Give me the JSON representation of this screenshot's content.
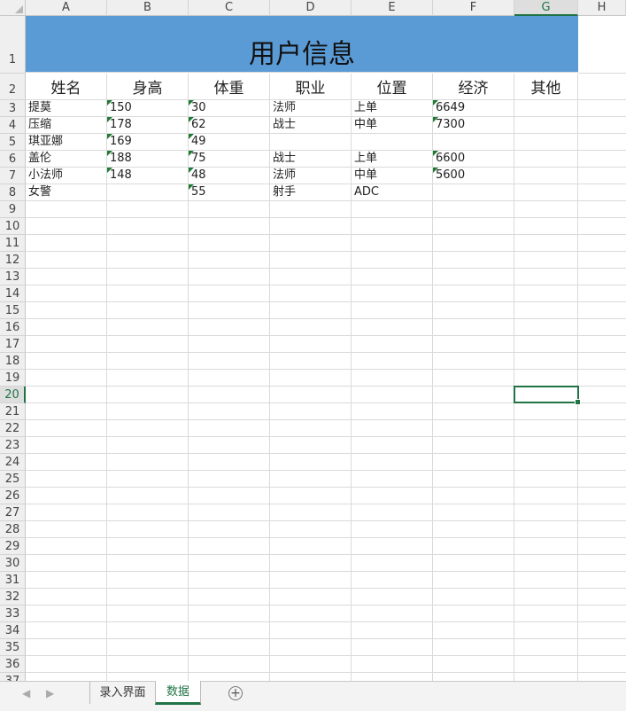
{
  "columns": [
    "A",
    "B",
    "C",
    "D",
    "E",
    "F",
    "G",
    "H"
  ],
  "rows": [
    "1",
    "2",
    "3",
    "4",
    "5",
    "6",
    "7",
    "8",
    "9",
    "10",
    "11",
    "12",
    "13",
    "14",
    "15",
    "16",
    "17",
    "18",
    "19",
    "20",
    "21",
    "22",
    "23",
    "24",
    "25",
    "26",
    "27",
    "28",
    "29",
    "30",
    "31",
    "32",
    "33",
    "34",
    "35",
    "36",
    "37"
  ],
  "selected_cell": {
    "column": "G",
    "row": "20"
  },
  "sheet": {
    "title": "用户信息",
    "title_fill": "#5b9bd5",
    "headers": [
      "姓名",
      "身高",
      "体重",
      "职业",
      "位置",
      "经济",
      "其他"
    ],
    "rows": [
      [
        "提莫",
        "150",
        "30",
        "法师",
        "上单",
        "6649",
        ""
      ],
      [
        "压缩",
        "178",
        "62",
        "战士",
        "中单",
        "7300",
        ""
      ],
      [
        "琪亚娜",
        "169",
        "49",
        "",
        "",
        "",
        ""
      ],
      [
        "盖伦",
        "188",
        "75",
        "战士",
        "上单",
        "6600",
        ""
      ],
      [
        "小法师",
        "148",
        "48",
        "法师",
        "中单",
        "5600",
        ""
      ],
      [
        "女警",
        "",
        "55",
        "射手",
        "ADC",
        "",
        ""
      ]
    ]
  },
  "tabs": {
    "tab1": "录入界面",
    "tab2": "数据"
  },
  "accent_color": "#217346"
}
